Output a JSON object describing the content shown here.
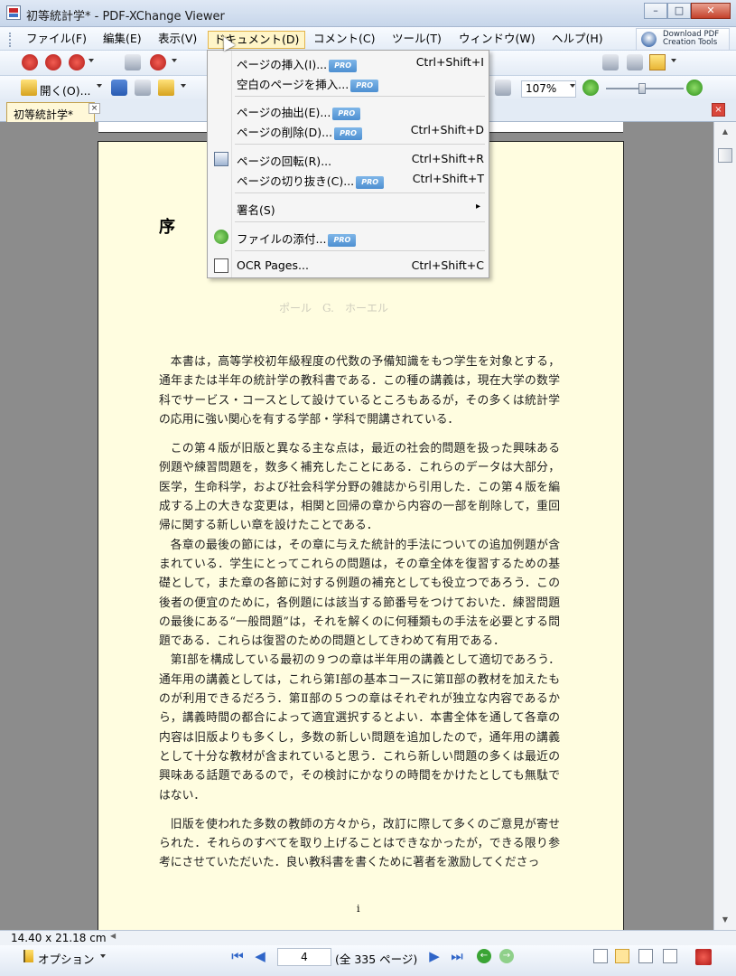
{
  "window": {
    "title": "初等統計学* - PDF-XChange Viewer",
    "minimize_label": "–",
    "maximize_label": "□",
    "close_label": "✕"
  },
  "menubar": {
    "items": [
      "ファイル(F)",
      "編集(E)",
      "表示(V)",
      "ドキュメント(D)",
      "コメント(C)",
      "ツール(T)",
      "ウィンドウ(W)",
      "ヘルプ(H)"
    ],
    "download_button": "Download PDF\nCreation Tools"
  },
  "toolbar": {
    "open_label": "開く(O)...",
    "zoom_value": "107%"
  },
  "tab": {
    "title": "初等統計学*",
    "close_label": "×",
    "panel_close_label": "×"
  },
  "document_menu": {
    "items": [
      {
        "label": "ページの挿入(I)...",
        "shortcut": "Ctrl+Shift+I",
        "pro": true,
        "icon": "none"
      },
      {
        "label": "空白のページを挿入...",
        "shortcut": "",
        "pro": true,
        "icon": "none"
      },
      {
        "label": "ページの抽出(E)...",
        "shortcut": "",
        "pro": true,
        "icon": "none"
      },
      {
        "label": "ページの削除(D)...",
        "shortcut": "Ctrl+Shift+D",
        "pro": true,
        "icon": "none"
      },
      {
        "label": "ページの回転(R)...",
        "shortcut": "Ctrl+Shift+R",
        "pro": false,
        "icon": "rotate-page-icon"
      },
      {
        "label": "ページの切り抜き(C)...",
        "shortcut": "Ctrl+Shift+T",
        "pro": true,
        "icon": "none"
      },
      {
        "label": "署名(S)",
        "shortcut": "",
        "pro": false,
        "icon": "none",
        "submenu": true
      },
      {
        "label": "ファイルの添付...",
        "shortcut": "",
        "pro": true,
        "icon": "attach-file-icon"
      },
      {
        "label": "OCR Pages...",
        "shortcut": "Ctrl+Shift+C",
        "pro": false,
        "icon": "ocr-icon"
      }
    ],
    "pro_badge": "PRO",
    "submenu_arrow": "▸"
  },
  "page": {
    "heading": "序",
    "ghost_text": "ポール　G.　ホーエル",
    "paragraphs": [
      "本書は，高等学校初年級程度の代数の予備知識をもつ学生を対象とする，通年または半年の統計学の教科書である．この種の講義は，現在大学の数学科でサービス・コースとして設けているところもあるが，その多くは統計学の応用に強い関心を有する学部・学科で開講されている．",
      "この第４版が旧版と異なる主な点は，最近の社会的問題を扱った興味ある例題や練習問題を，数多く補充したことにある．これらのデータは大部分，医学，生命科学，および社会科学分野の雑誌から引用した．この第４版を編成する上の大きな変更は，相関と回帰の章から内容の一部を削除して，重回帰に関する新しい章を設けたことである．",
      "各章の最後の節には，その章に与えた統計的手法についての追加例題が含まれている．学生にとってこれらの問題は，その章全体を復習するための基礎として，また章の各節に対する例題の補充としても役立つであろう．この後者の便宜のために，各例題には該当する節番号をつけておいた．練習問題の最後にある“一般問題”は，それを解くのに何種類もの手法を必要とする問題である．これらは復習のための問題としてきわめて有用である．",
      "第Ⅰ部を構成している最初の９つの章は半年用の講義として適切であろう．通年用の講義としては，これら第Ⅰ部の基本コースに第Ⅱ部の教材を加えたものが利用できるだろう．第Ⅱ部の５つの章はそれぞれが独立な内容であるから，講義時間の都合によって適宜選択するとよい．本書全体を通して各章の内容は旧版よりも多くし，多数の新しい問題を追加したので，通年用の講義として十分な教材が含まれていると思う．これら新しい問題の多くは最近の興味ある話題であるので，その検討にかなりの時間をかけたとしても無駄ではない．",
      "旧版を使われた多数の教師の方々から，改訂に際して多くのご意見が寄せられた．それらのすべてを取り上げることはできなかったが，できる限り参考にさせていただいた．良い教科書を書くために著者を激励してくださっ"
    ],
    "page_number": "i"
  },
  "status": {
    "page_size": "14.40 x 21.18 cm"
  },
  "navbar": {
    "options_label": "オプション",
    "current_page": "4",
    "total_label": "(全 335 ページ)"
  }
}
